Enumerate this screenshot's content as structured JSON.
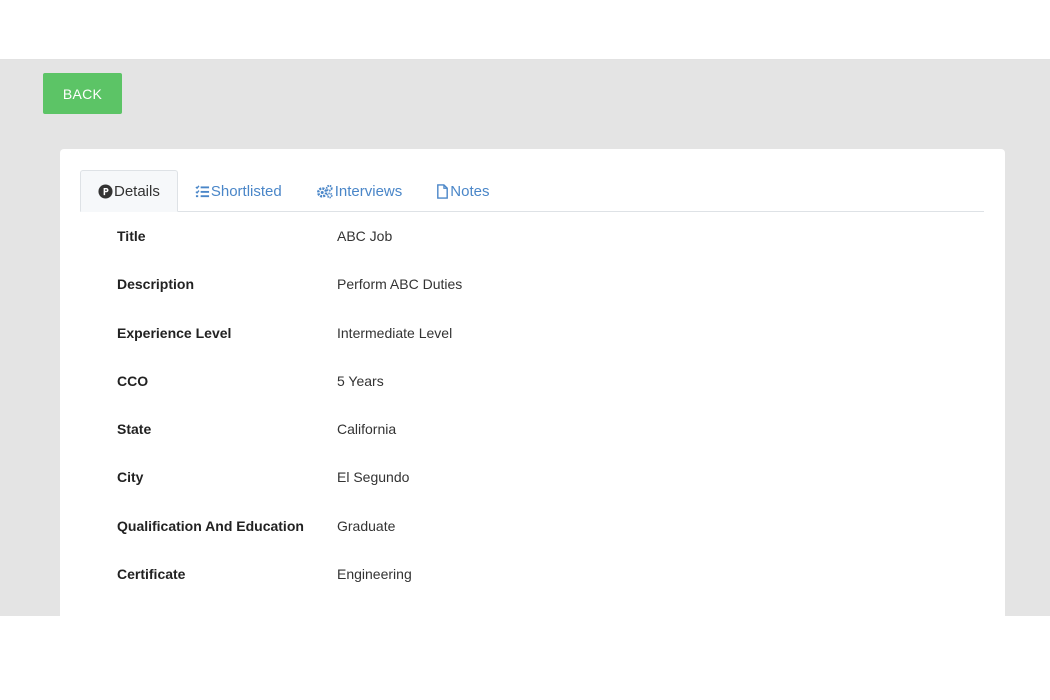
{
  "back_button": {
    "label": "BACK"
  },
  "tabs": [
    {
      "label": "Details",
      "icon": "product-hunt-icon",
      "active": true
    },
    {
      "label": "Shortlisted",
      "icon": "list-check-icon",
      "active": false
    },
    {
      "label": "Interviews",
      "icon": "cogs-icon",
      "active": false
    },
    {
      "label": "Notes",
      "icon": "file-icon",
      "active": false
    }
  ],
  "details": [
    {
      "label": "Title",
      "value": "ABC Job"
    },
    {
      "label": "Description",
      "value": "Perform ABC Duties"
    },
    {
      "label": "Experience Level",
      "value": "Intermediate Level"
    },
    {
      "label": "CCO",
      "value": "5 Years"
    },
    {
      "label": "State",
      "value": "California"
    },
    {
      "label": "City",
      "value": "El Segundo"
    },
    {
      "label": "Qualification And Education",
      "value": "Graduate"
    },
    {
      "label": "Certificate",
      "value": "Engineering"
    }
  ],
  "colors": {
    "accent_green": "#5cc466",
    "link_blue": "#4a86c8",
    "page_background": "#e4e4e4"
  }
}
